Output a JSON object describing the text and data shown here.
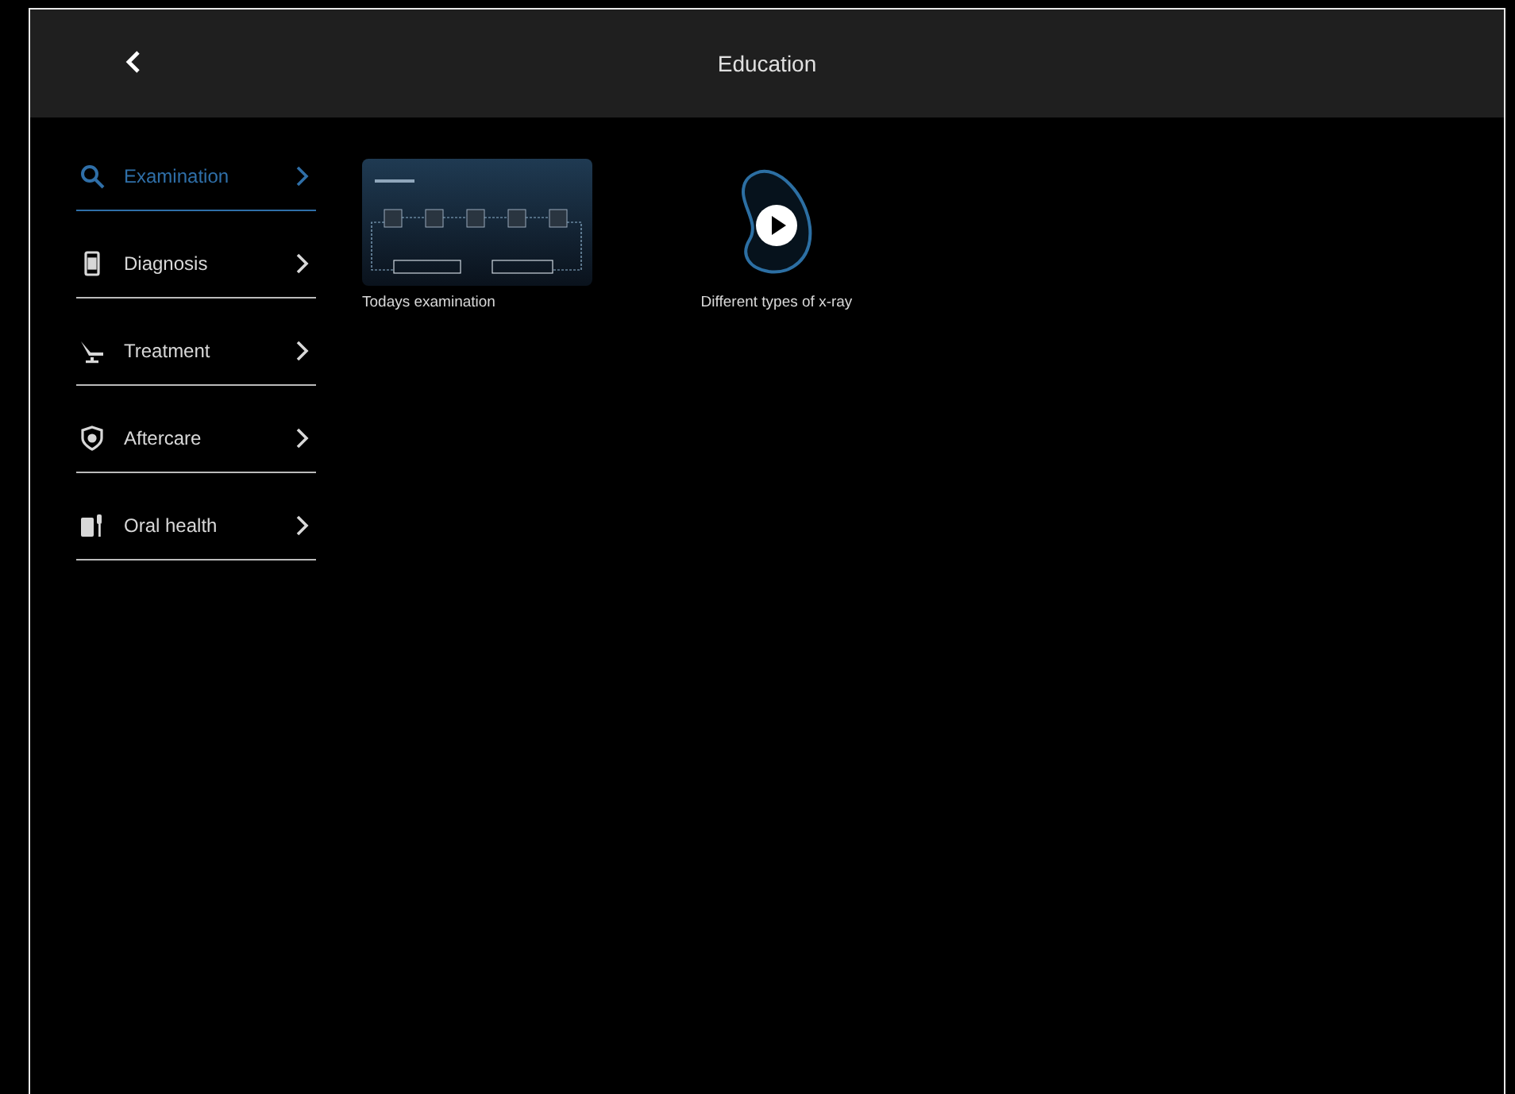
{
  "header": {
    "title": "Education"
  },
  "sidebar": {
    "items": [
      {
        "label": "Examination",
        "selected": true
      },
      {
        "label": "Diagnosis",
        "selected": false
      },
      {
        "label": "Treatment",
        "selected": false
      },
      {
        "label": "Aftercare",
        "selected": false
      },
      {
        "label": "Oral health",
        "selected": false
      }
    ]
  },
  "cards": [
    {
      "kind": "slide",
      "title": "Todays examination"
    },
    {
      "kind": "video",
      "title": "Different types of x-ray"
    }
  ]
}
